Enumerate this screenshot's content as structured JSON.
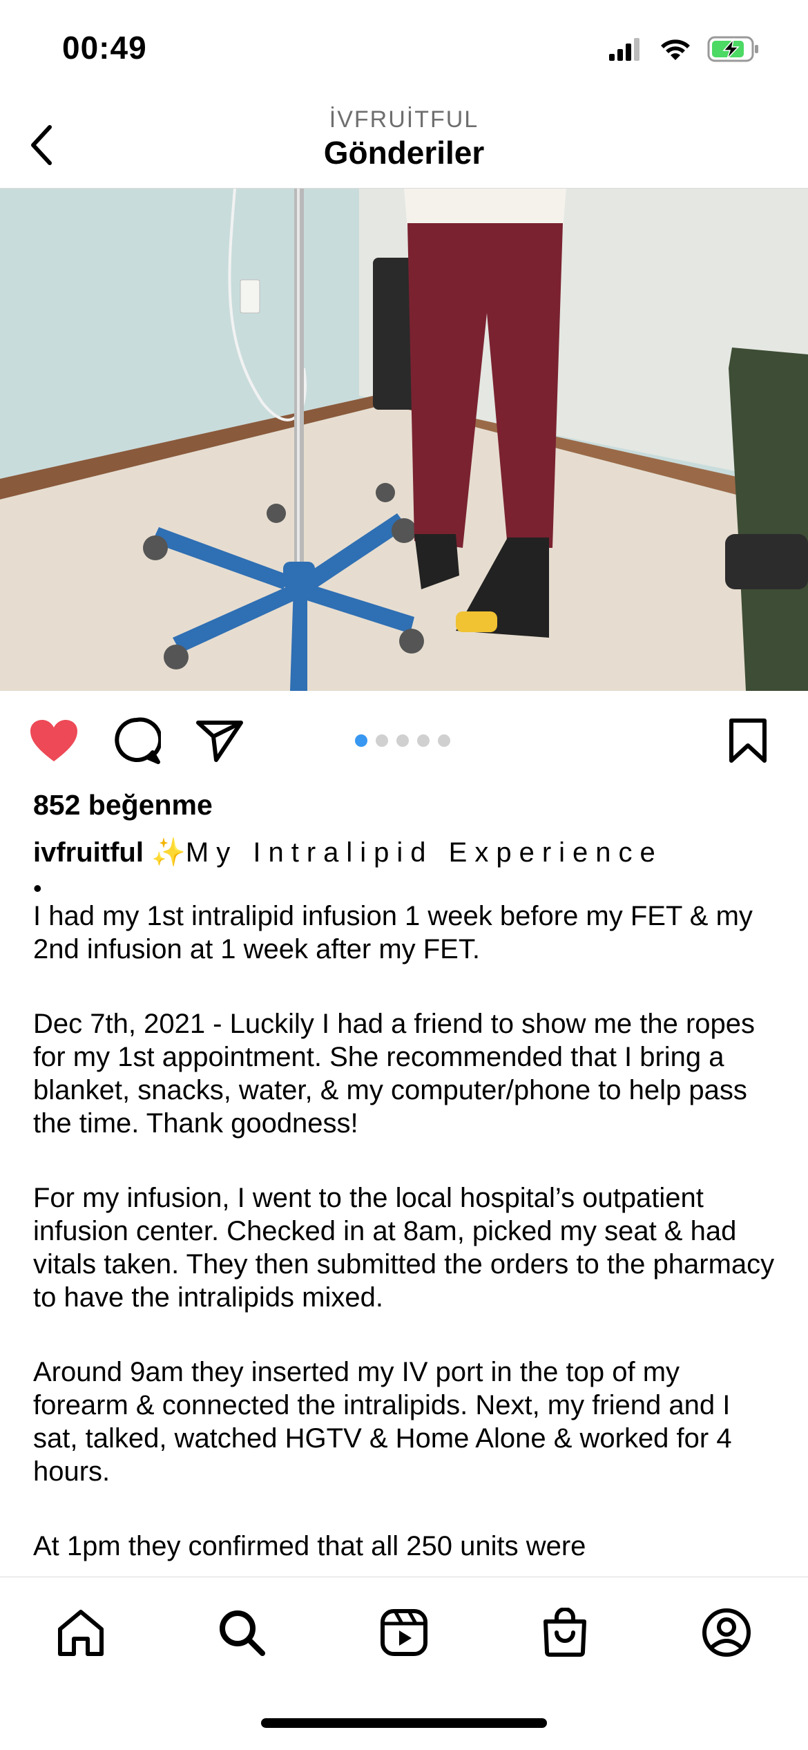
{
  "status_bar": {
    "time": "00:49",
    "battery_charging": true
  },
  "header": {
    "account": "İVFRUİTFUL",
    "title": "Gönderiler"
  },
  "post": {
    "carousel": {
      "count": 5,
      "active_index": 0
    },
    "likes": "852 beğenme",
    "caption": {
      "username": "ivfruitful",
      "emoji": "✨",
      "title": "My Intralipid Experience",
      "bullet": "•",
      "paragraphs": [
        "I had my 1st intralipid infusion 1 week before my FET & my 2nd infusion at 1 week after my FET.",
        "Dec 7th, 2021 - Luckily I had a friend to show me the ropes for my 1st appointment. She recommended that I bring a blanket, snacks, water, & my computer/phone to help pass the time. Thank goodness!",
        "For my infusion, I went to the local hospital’s outpatient infusion center. Checked in at 8am, picked my seat & had vitals taken. They then submitted the orders to the pharmacy to have the intralipids mixed.",
        "Around 9am they inserted my IV port in the top of my forearm & connected the intralipids. Next, my friend and I sat, talked, watched HGTV & Home Alone & worked for 4 hours.",
        "At 1pm they confirmed that all 250 units were"
      ]
    }
  },
  "colors": {
    "like_red": "#ED4956",
    "active_dot": "#3897F0",
    "inactive_dot": "#D0D0D0"
  },
  "nav": [
    "home-icon",
    "search-icon",
    "reels-icon",
    "shop-icon",
    "profile-icon"
  ]
}
